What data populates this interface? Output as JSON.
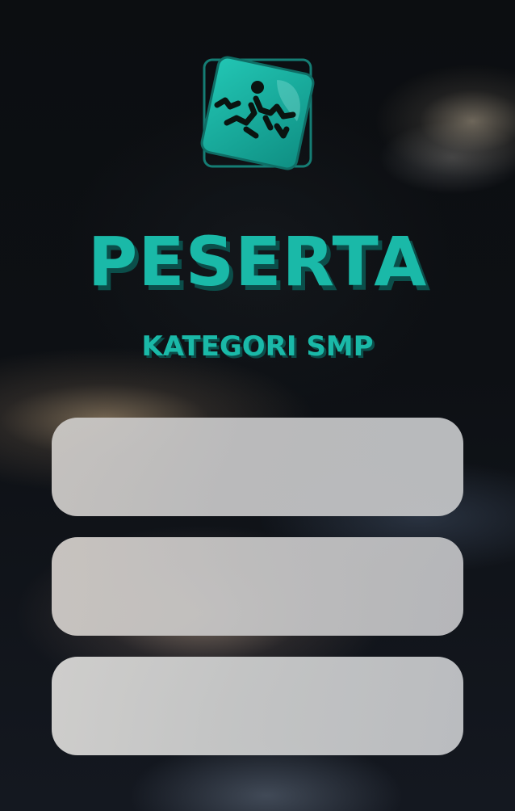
{
  "logo": {
    "icon": "figure-logo-icon",
    "accent_color": "#1ab9a8",
    "shadow_color": "#0b4e4a"
  },
  "title": "PESERTA",
  "subtitle": "KATEGORI SMP",
  "fields": [
    {
      "value": ""
    },
    {
      "value": ""
    },
    {
      "value": ""
    }
  ]
}
